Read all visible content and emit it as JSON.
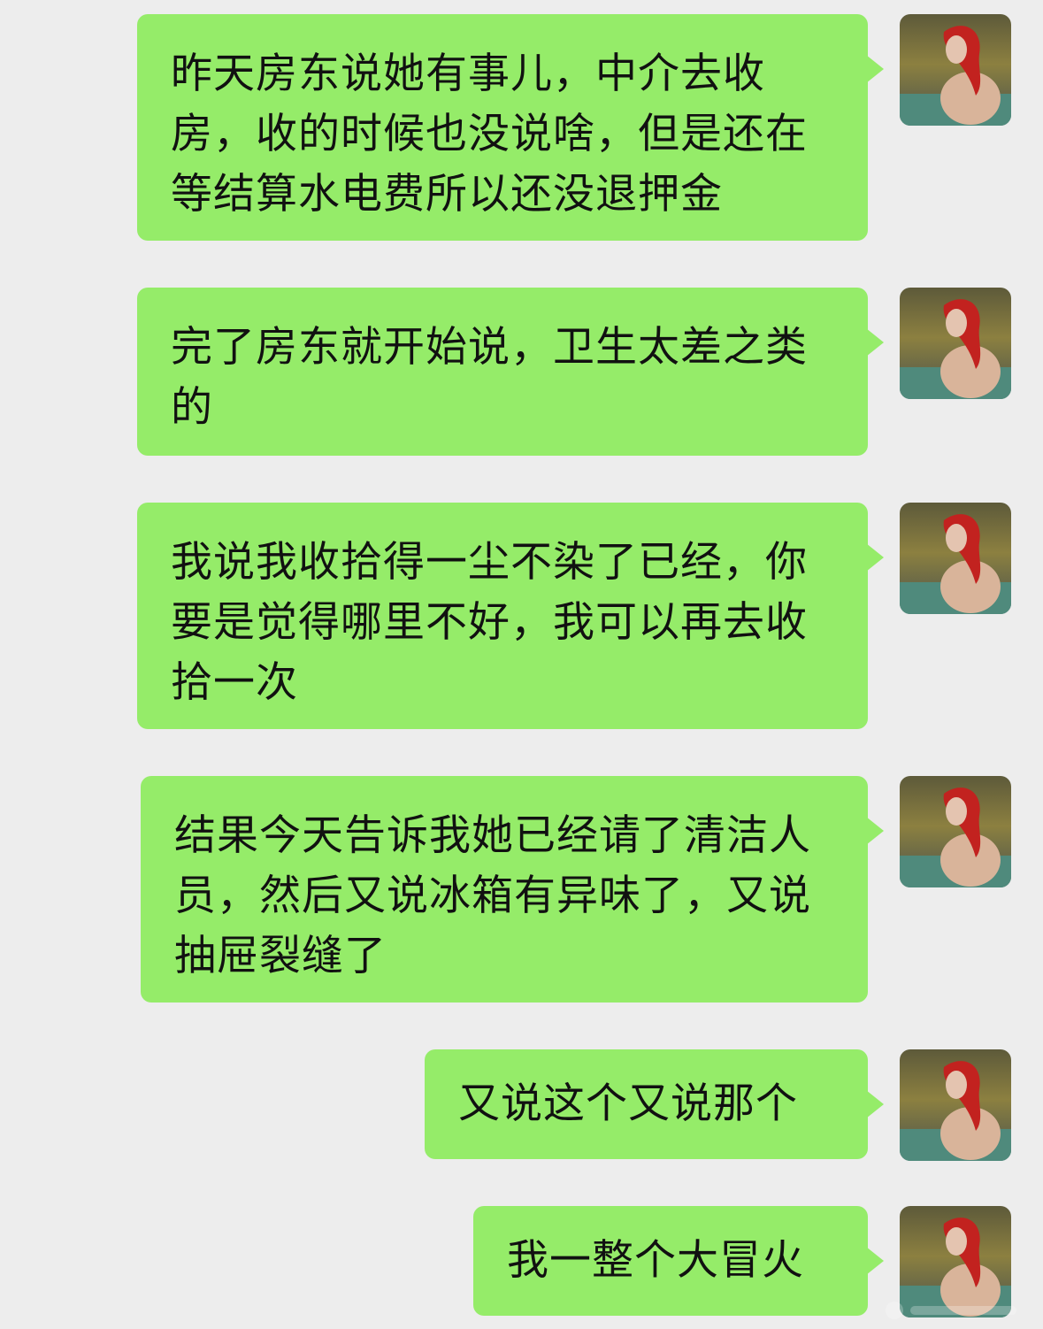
{
  "messages": [
    {
      "text": "昨天房东说她有事儿，中介去收房，收的时候也没说啥，但是还在等结算水电费所以还没退押金"
    },
    {
      "text": "完了房东就开始说，卫生太差之类的"
    },
    {
      "text": "我说我收拾得一尘不染了已经，你要是觉得哪里不好，我可以再去收拾一次"
    },
    {
      "text": "结果今天告诉我她已经请了清洁人员，然后又说冰箱有异味了，又说抽屉裂缝了"
    },
    {
      "text": "又说这个又说那个"
    },
    {
      "text": "我一整个大冒火"
    }
  ],
  "colors": {
    "background": "#ededed",
    "bubble": "#95ec69",
    "text": "#111111"
  },
  "icons": {
    "avatar": "avatar-image"
  }
}
